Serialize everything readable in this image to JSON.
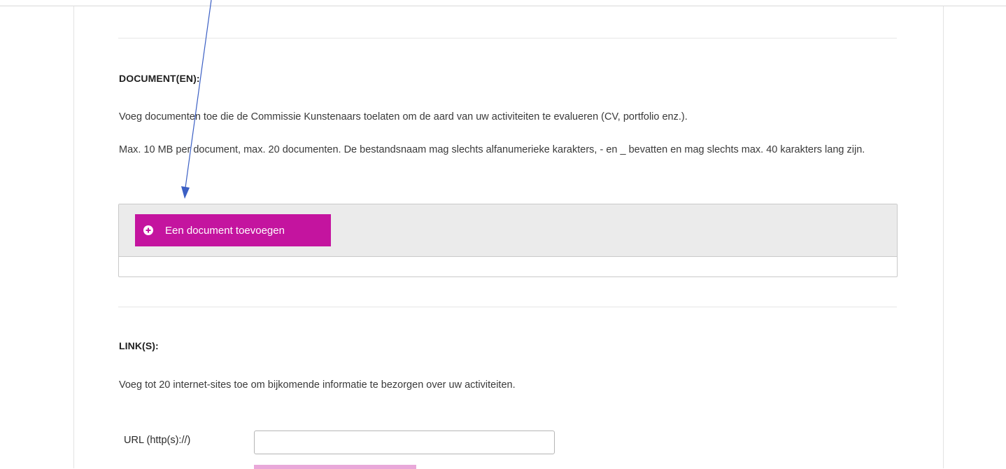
{
  "documents": {
    "title": "DOCUMENT(EN):",
    "description": "Voeg documenten toe die de Commissie Kunstenaars toelaten om de aard van uw activiteiten te evalueren (CV, portfolio enz.).",
    "limits": "Max. 10 MB per document, max. 20 documenten. De bestandsnaam mag slechts alfanumerieke karakters, - en _ bevatten en mag slechts max. 40 karakters lang zijn.",
    "add_button_label": "Een document toevoegen",
    "add_button_icon": "plus-circle-icon"
  },
  "links": {
    "title": "LINK(S):",
    "description": "Voeg tot 20 internet-sites toe om bijkomende informatie te bezorgen over uw activiteiten.",
    "url_label": "URL (http(s)://)",
    "url_value": "",
    "url_placeholder": ""
  },
  "colors": {
    "accent": "#c4149f",
    "annotation_arrow": "#3b5fc4"
  }
}
